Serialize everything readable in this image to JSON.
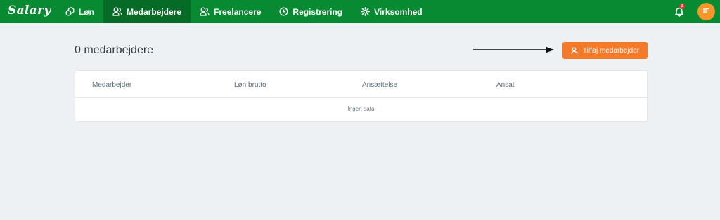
{
  "app": {
    "logo": "Salary"
  },
  "nav": {
    "items": [
      {
        "label": "Løn",
        "icon": "coins-icon"
      },
      {
        "label": "Medarbejdere",
        "icon": "users-icon",
        "active": true
      },
      {
        "label": "Freelancere",
        "icon": "users-icon"
      },
      {
        "label": "Registrering",
        "icon": "clock-icon"
      },
      {
        "label": "Virksomhed",
        "icon": "gear-icon"
      }
    ]
  },
  "header": {
    "notification_count": "1",
    "avatar_initials": "IE"
  },
  "main": {
    "title": "0 medarbejdere",
    "add_button_label": "Tilføj medarbejder",
    "table": {
      "columns": [
        "Medarbejder",
        "Løn brutto",
        "Ansættelse",
        "Ansat"
      ],
      "empty_text": "Ingen data"
    }
  },
  "colors": {
    "topbar": "#078a32",
    "topbar_active": "#056b27",
    "accent": "#f47a2a",
    "avatar": "#f7942a",
    "badge": "#e8312f"
  }
}
